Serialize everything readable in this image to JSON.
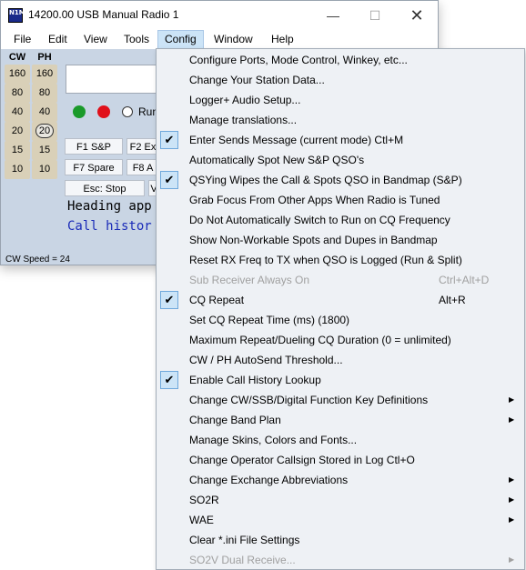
{
  "window": {
    "title": "14200.00 USB Manual Radio 1",
    "app_icon_text": "N1MM",
    "min_glyph": "—",
    "max_glyph": "☐",
    "close_glyph": "✕"
  },
  "menubar": [
    "File",
    "Edit",
    "View",
    "Tools",
    "Config",
    "Window",
    "Help"
  ],
  "bands": {
    "cw_label": "CW",
    "ph_label": "PH",
    "cw": [
      "160",
      "80",
      "40",
      "20",
      "15",
      "10"
    ],
    "ph": [
      "160",
      "80",
      "40",
      "20",
      "15",
      "10"
    ],
    "selected_ph": "20"
  },
  "main": {
    "run_label": "Run",
    "function_keys": [
      "F1 S&P",
      "F2 Ex",
      "F7 Spare",
      "F8 A",
      "Esc: Stop",
      "V"
    ],
    "heading_text": "Heading app",
    "call_history_text": "Call histor",
    "cw_speed": "CW Speed = 24"
  },
  "colors": {
    "led_green": "#1a9a2a",
    "led_red": "#e0101a",
    "call_history_blue": "#1a2bb8"
  },
  "config_menu": [
    {
      "label": "Configure Ports, Mode Control, Winkey, etc...",
      "checked": false
    },
    {
      "label": "Change Your Station Data...",
      "checked": false
    },
    {
      "label": "Logger+ Audio Setup...",
      "checked": false
    },
    {
      "label": "Manage translations...",
      "checked": false
    },
    {
      "label": "Enter Sends Message (current mode)  Ctl+M",
      "checked": true
    },
    {
      "label": "Automatically Spot New S&P QSO's",
      "checked": false
    },
    {
      "label": "QSYing Wipes the Call & Spots QSO in Bandmap (S&P)",
      "checked": true
    },
    {
      "label": "Grab Focus From Other Apps When Radio is Tuned",
      "checked": false
    },
    {
      "label": "Do Not Automatically Switch to Run on CQ Frequency",
      "checked": false
    },
    {
      "label": "Show Non-Workable Spots and Dupes in Bandmap",
      "checked": false
    },
    {
      "label": "Reset RX Freq to TX when QSO is Logged (Run & Split)",
      "checked": false
    },
    {
      "label": "Sub Receiver Always On",
      "shortcut": "Ctrl+Alt+D",
      "disabled": true
    },
    {
      "label": "CQ Repeat",
      "shortcut": "Alt+R",
      "checked": true
    },
    {
      "label": "Set CQ Repeat Time (ms) (1800)",
      "checked": false
    },
    {
      "label": "Maximum Repeat/Dueling CQ Duration (0 = unlimited)",
      "checked": false
    },
    {
      "label": "CW / PH AutoSend Threshold...",
      "checked": false
    },
    {
      "label": "Enable Call History Lookup",
      "checked": true
    },
    {
      "label": "Change CW/SSB/Digital Function Key Definitions",
      "submenu": true
    },
    {
      "label": "Change Band Plan",
      "submenu": true
    },
    {
      "label": "Manage Skins, Colors and Fonts...",
      "checked": false
    },
    {
      "label": "Change Operator Callsign Stored in Log   Ctl+O",
      "checked": false
    },
    {
      "label": "Change Exchange Abbreviations",
      "submenu": true
    },
    {
      "label": "SO2R",
      "submenu": true
    },
    {
      "label": "WAE",
      "submenu": true
    },
    {
      "label": "Clear *.ini File Settings",
      "checked": false
    },
    {
      "label": "SO2V Dual Receive...",
      "submenu": true,
      "disabled": true
    }
  ],
  "glyphs": {
    "check": "✔",
    "submenu_arrow": "▶"
  }
}
